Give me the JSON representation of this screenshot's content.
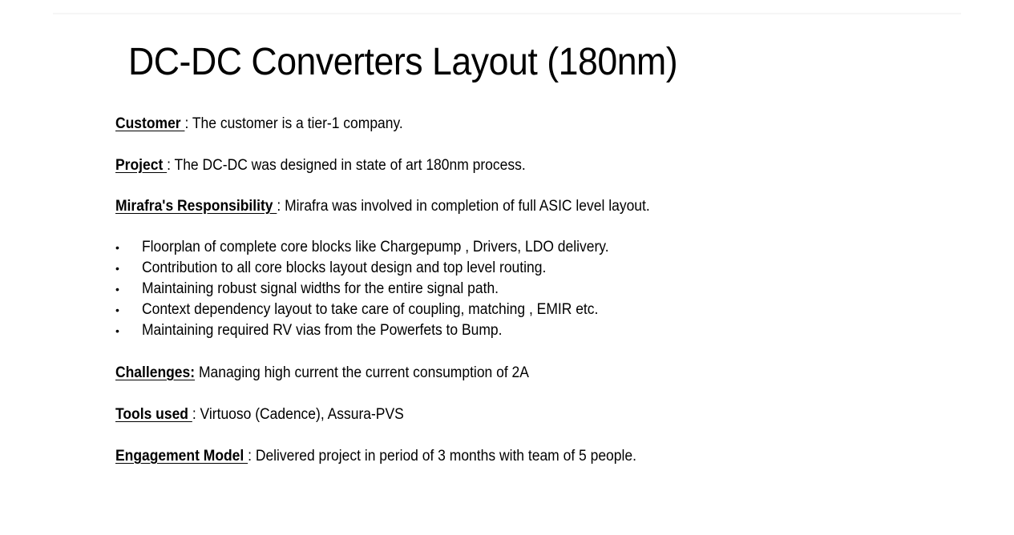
{
  "slide": {
    "title": "DC-DC Converters Layout (180nm)",
    "customer": {
      "label": "Customer ",
      "text": ": The customer is a tier-1 company."
    },
    "project": {
      "label": "Project ",
      "text": ": The DC-DC was designed in state of art 180nm process."
    },
    "responsibility": {
      "label": "Mirafra's Responsibility ",
      "text": ": Mirafra was involved in completion of  full ASIC level layout."
    },
    "bullet_glyph": "•",
    "bullets": [
      "Floorplan of complete core blocks like  Chargepump , Drivers, LDO delivery.",
      "Contribution to all core blocks layout design and top level routing.",
      "Maintaining robust signal widths for the entire signal path.",
      "Context dependency layout to take care of coupling, matching , EMIR etc.",
      "Maintaining required RV vias from the Powerfets to Bump."
    ],
    "challenges": {
      "label": "Challenges:",
      "text": " Managing high current the  current consumption of 2A"
    },
    "tools": {
      "label": "Tools used ",
      "text": ": Virtuoso (Cadence), Assura-PVS"
    },
    "engagement": {
      "label": "Engagement Model ",
      "text": ": Delivered project in period of 3 months with team of 5 people."
    }
  }
}
